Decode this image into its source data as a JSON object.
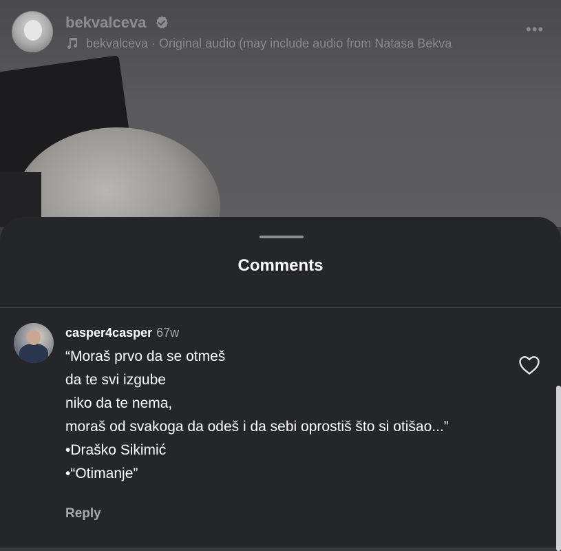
{
  "header": {
    "username": "bekvalceva",
    "audio_text": "bekvalceva · Original audio  (may include audio from Natasa Bekva",
    "more_label": "•••"
  },
  "sheet": {
    "title": "Comments"
  },
  "comment": {
    "user": "casper4casper",
    "time": "67w",
    "lines": [
      "“Moraš prvo da se otmeš",
      "da te svi izgube",
      "niko da te nema,",
      "moraš od svakoga da odeš i da sebi oprostiš što si otišao...”",
      "•Draško Sikimić",
      "•“Otimanje”"
    ],
    "reply_label": "Reply"
  },
  "colors": {
    "sheet_bg": "#252629",
    "text_primary": "#ffffff",
    "text_secondary": "#a8a8ad"
  },
  "icons": [
    "verified-badge-icon",
    "music-note-icon",
    "more-options-icon",
    "heart-icon"
  ]
}
